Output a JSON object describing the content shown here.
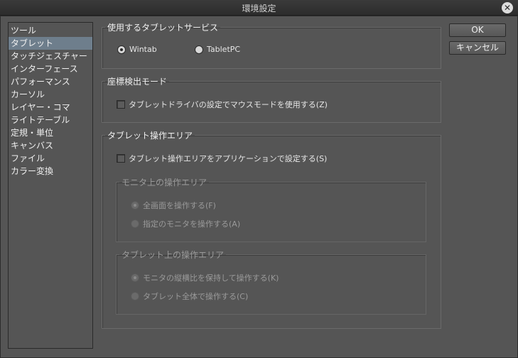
{
  "window": {
    "title": "環境設定"
  },
  "categories": [
    {
      "label": "ツール"
    },
    {
      "label": "タブレット"
    },
    {
      "label": "タッチジェスチャー"
    },
    {
      "label": "インターフェース"
    },
    {
      "label": "パフォーマンス"
    },
    {
      "label": "カーソル"
    },
    {
      "label": "レイヤー・コマ"
    },
    {
      "label": "ライトテーブル"
    },
    {
      "label": "定規・単位"
    },
    {
      "label": "キャンバス"
    },
    {
      "label": "ファイル"
    },
    {
      "label": "カラー変換"
    }
  ],
  "selected_category": "タブレット",
  "tablet_service": {
    "legend": "使用するタブレットサービス",
    "options": [
      {
        "label": "Wintab",
        "selected": true
      },
      {
        "label": "TabletPC",
        "selected": false
      }
    ]
  },
  "coord_mode": {
    "legend": "座標検出モード",
    "checkbox_label": "タブレットドライバの設定でマウスモードを使用する(Z)",
    "checked": false
  },
  "operation_area": {
    "legend": "タブレット操作エリア",
    "checkbox_label": "タブレット操作エリアをアプリケーションで設定する(S)",
    "checked": false,
    "monitor_area": {
      "legend": "モニタ上の操作エリア",
      "options": [
        {
          "label": "全画面を操作する(F)",
          "selected": true
        },
        {
          "label": "指定のモニタを操作する(A)",
          "selected": false
        }
      ]
    },
    "tablet_area": {
      "legend": "タブレット上の操作エリア",
      "options": [
        {
          "label": "モニタの縦横比を保持して操作する(K)",
          "selected": true
        },
        {
          "label": "タブレット全体で操作する(C)",
          "selected": false
        }
      ]
    }
  },
  "buttons": {
    "ok": "OK",
    "cancel": "キャンセル"
  }
}
